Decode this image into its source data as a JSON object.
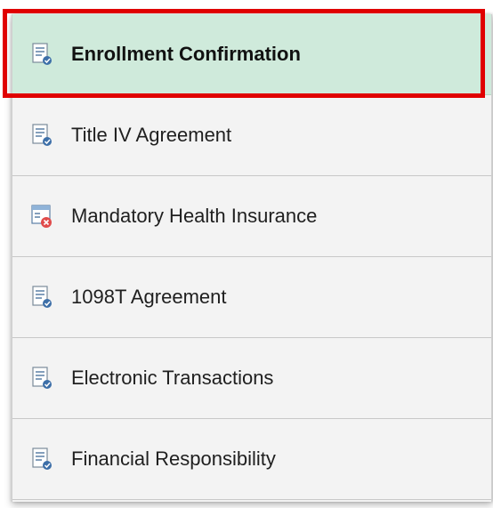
{
  "menu": {
    "items": [
      {
        "label": "Enrollment Confirmation",
        "icon": "document-edit-icon",
        "active": true
      },
      {
        "label": "Title IV Agreement",
        "icon": "document-edit-icon",
        "active": false
      },
      {
        "label": "Mandatory Health Insurance",
        "icon": "document-error-icon",
        "active": false
      },
      {
        "label": "1098T Agreement",
        "icon": "document-edit-icon",
        "active": false
      },
      {
        "label": "Electronic Transactions",
        "icon": "document-edit-icon",
        "active": false
      },
      {
        "label": "Financial Responsibility",
        "icon": "document-edit-icon",
        "active": false
      }
    ]
  },
  "colors": {
    "active_background": "#cfeadb",
    "highlight_border": "#e00000",
    "panel_background": "#f3f3f3"
  }
}
